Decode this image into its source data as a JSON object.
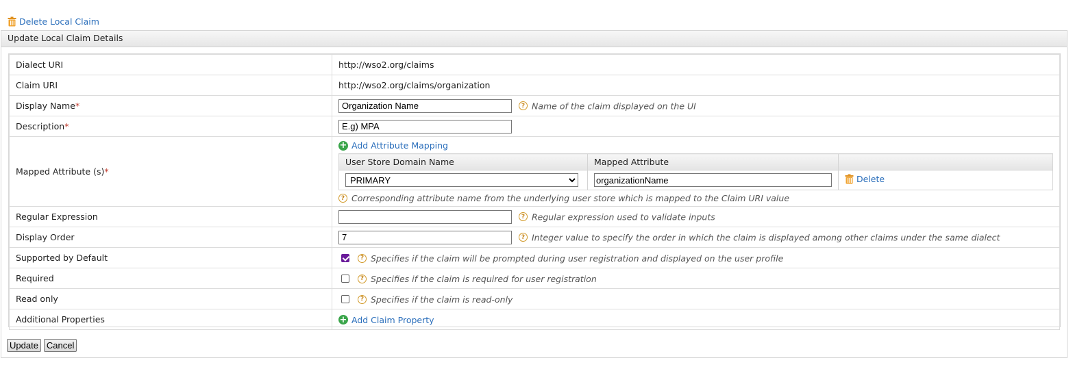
{
  "top_link": {
    "label": "Delete Local Claim"
  },
  "panel": {
    "title": "Update Local Claim Details"
  },
  "rows": {
    "dialect_uri": {
      "label": "Dialect URI",
      "value": "http://wso2.org/claims"
    },
    "claim_uri": {
      "label": "Claim URI",
      "value": "http://wso2.org/claims/organization"
    },
    "display_name": {
      "label": "Display Name",
      "required_mark": "*",
      "value": "Organization Name",
      "hint": "Name of the claim displayed on the UI"
    },
    "description": {
      "label": "Description",
      "required_mark": "*",
      "value": "E.g) MPA"
    },
    "mapped_attributes": {
      "label": "Mapped Attribute (s)",
      "required_mark": "*",
      "add_link": "Add Attribute Mapping",
      "columns": [
        "User Store Domain Name",
        "Mapped Attribute"
      ],
      "mapping": {
        "domain": "PRIMARY",
        "attribute": "organizationName",
        "delete_label": "Delete"
      },
      "hint": "Corresponding attribute name from the underlying user store which is mapped to the Claim URI value"
    },
    "regex": {
      "label": "Regular Expression",
      "value": "",
      "hint": "Regular expression used to validate inputs"
    },
    "display_order": {
      "label": "Display Order",
      "value": "7",
      "hint": "Integer value to specify the order in which the claim is displayed among other claims under the same dialect"
    },
    "supported_by_default": {
      "label": "Supported by Default",
      "checked": true,
      "hint": "Specifies if the claim will be prompted during user registration and displayed on the user profile"
    },
    "required": {
      "label": "Required",
      "checked": false,
      "hint": "Specifies if the claim is required for user registration"
    },
    "read_only": {
      "label": "Read only",
      "checked": false,
      "hint": "Specifies if the claim is read-only"
    },
    "additional_properties": {
      "label": "Additional Properties",
      "add_link": "Add Claim Property"
    }
  },
  "buttons": {
    "update": "Update",
    "cancel": "Cancel"
  },
  "help_glyph": "?",
  "icons": {
    "delete": "trash-icon",
    "add": "plus-circle-icon",
    "help": "help-icon"
  },
  "colors": {
    "link": "#2a6ebb",
    "required": "#c0392b",
    "add_icon": "#3aa54a",
    "help_icon": "#d29a2a"
  }
}
